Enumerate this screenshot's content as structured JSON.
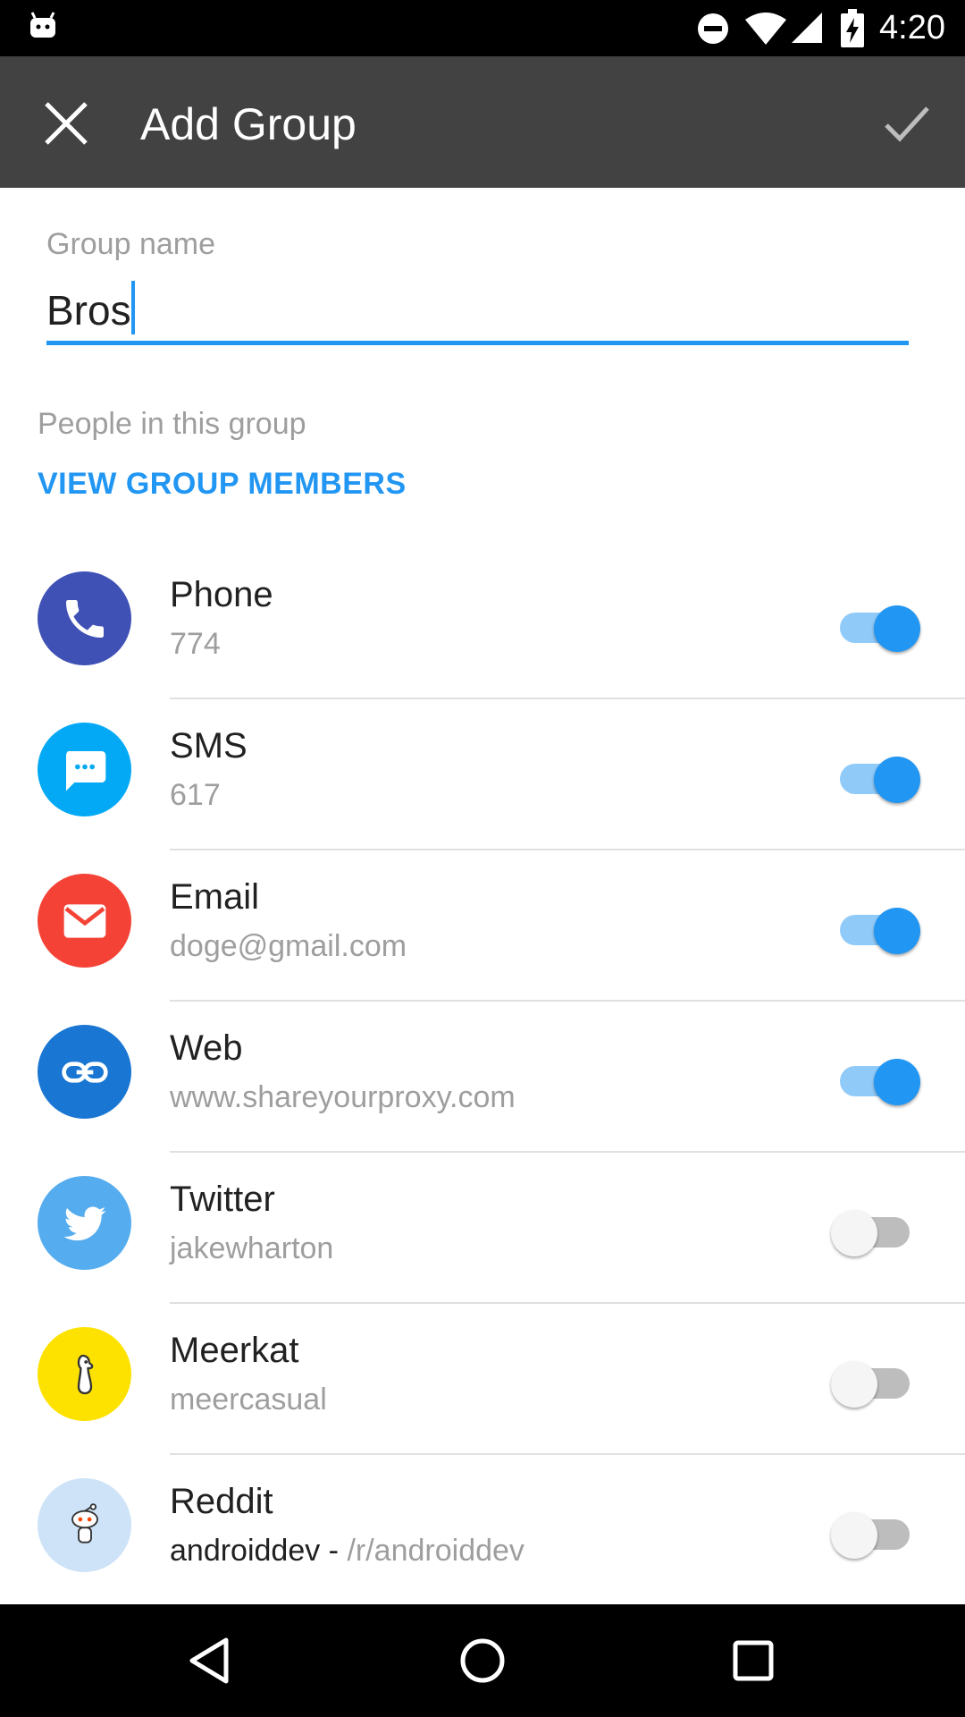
{
  "status_bar": {
    "time": "4:20",
    "icons": [
      "android-icon",
      "do-not-disturb-icon",
      "wifi-icon",
      "signal-icon",
      "battery-charging-icon"
    ]
  },
  "toolbar": {
    "title": "Add Group",
    "close_icon": "close-icon",
    "confirm_icon": "check-icon",
    "background": "#424242"
  },
  "group_name": {
    "label": "Group name",
    "value": "Bros",
    "accent": "#2196f3"
  },
  "members": {
    "label": "People in this group",
    "link": "VIEW GROUP MEMBERS"
  },
  "services": [
    {
      "name": "Phone",
      "detail": "774",
      "icon": "phone-icon",
      "color": "#3f51b5",
      "enabled": true
    },
    {
      "name": "SMS",
      "detail": "617",
      "icon": "sms-icon",
      "color": "#03a9f4",
      "enabled": true
    },
    {
      "name": "Email",
      "detail": "doge@gmail.com",
      "icon": "email-icon",
      "color": "#f44336",
      "enabled": true
    },
    {
      "name": "Web",
      "detail": "www.shareyourproxy.com",
      "icon": "link-icon",
      "color": "#1976d2",
      "enabled": true
    },
    {
      "name": "Twitter",
      "detail": "jakewharton",
      "icon": "twitter-icon",
      "color": "#55acee",
      "enabled": false
    },
    {
      "name": "Meerkat",
      "detail": "meercasual",
      "icon": "meerkat-icon",
      "color": "#fde200",
      "enabled": false
    },
    {
      "name": "Reddit",
      "detail_strong": "androiddev - ",
      "detail": "/r/androiddev",
      "icon": "reddit-icon",
      "color": "#cee3f8",
      "enabled": false
    }
  ],
  "nav_bar": {
    "icons": [
      "back-icon",
      "home-icon",
      "recents-icon"
    ]
  }
}
